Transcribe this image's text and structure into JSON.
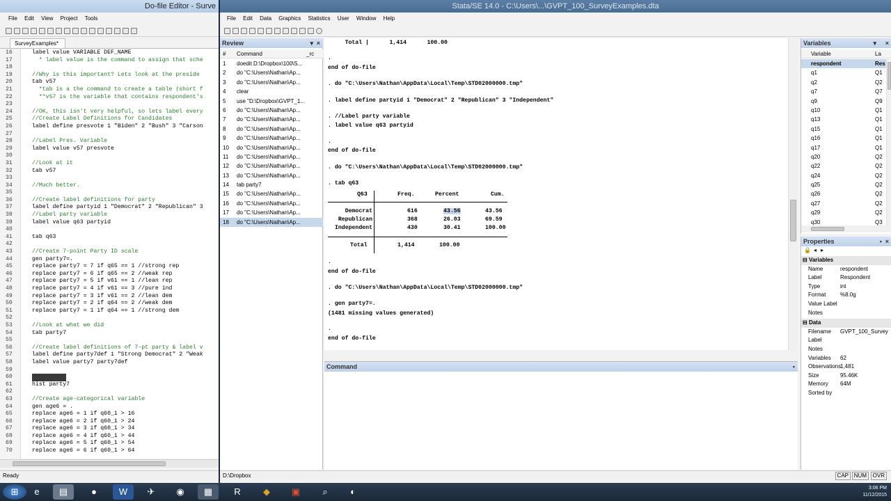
{
  "dofile": {
    "title": "Do-file Editor - Surve",
    "menu": [
      "File",
      "Edit",
      "View",
      "Project",
      "Tools"
    ],
    "tab": "SurveyExamples*",
    "status": "Ready",
    "lines": [
      {
        "n": "16",
        "t": "label value VARIABLE DEF_NAME"
      },
      {
        "n": "17",
        "t": "  * label value is the command to assign that sche"
      },
      {
        "n": "18",
        "t": ""
      },
      {
        "n": "19",
        "t": "//Why is this important? Lets look at the preside"
      },
      {
        "n": "20",
        "t": "tab v57"
      },
      {
        "n": "21",
        "t": "  *tab is a the command to create a table (short f"
      },
      {
        "n": "22",
        "t": "  **v57 is the variable that contains respondent's"
      },
      {
        "n": "23",
        "t": ""
      },
      {
        "n": "24",
        "t": "//OK, this isn't very helpful, so lets label every"
      },
      {
        "n": "25",
        "t": "//Create Label Definitions for Candidates"
      },
      {
        "n": "26",
        "t": "label define presvote 1 \"Biden\" 2 \"Bush\" 3 \"Carson"
      },
      {
        "n": "27",
        "t": ""
      },
      {
        "n": "28",
        "t": "//Label Pres. Variable"
      },
      {
        "n": "29",
        "t": "label value v57 presvote"
      },
      {
        "n": "30",
        "t": ""
      },
      {
        "n": "31",
        "t": "//Look at it"
      },
      {
        "n": "32",
        "t": "tab v57"
      },
      {
        "n": "33",
        "t": ""
      },
      {
        "n": "34",
        "t": "//Much better."
      },
      {
        "n": "35",
        "t": ""
      },
      {
        "n": "36",
        "t": "//Create label definitions for party"
      },
      {
        "n": "37",
        "t": "label define partyid 1 \"Democrat\" 2 \"Republican\" 3"
      },
      {
        "n": "38",
        "t": "//Label party variable"
      },
      {
        "n": "39",
        "t": "label value q63 partyid"
      },
      {
        "n": "40",
        "t": ""
      },
      {
        "n": "41",
        "t": "tab q63"
      },
      {
        "n": "42",
        "t": ""
      },
      {
        "n": "43",
        "t": "//Create 7-point Party ID scale"
      },
      {
        "n": "44",
        "t": "gen party7=."
      },
      {
        "n": "45",
        "t": "replace party7 = 7 if q65 == 1 //strong rep"
      },
      {
        "n": "46",
        "t": "replace party7 = 6 if q65 == 2 //weak rep"
      },
      {
        "n": "47",
        "t": "replace party7 = 5 if v61 == 1 //lean rep"
      },
      {
        "n": "48",
        "t": "replace party7 = 4 if v61 == 3 //pure ind"
      },
      {
        "n": "49",
        "t": "replace party7 = 3 if v61 == 2 //lean dem"
      },
      {
        "n": "50",
        "t": "replace party7 = 2 if q64 == 2 //weak dem"
      },
      {
        "n": "51",
        "t": "replace party7 = 1 if q64 == 1 //strong dem"
      },
      {
        "n": "52",
        "t": ""
      },
      {
        "n": "53",
        "t": "//Look at what we did"
      },
      {
        "n": "54",
        "t": "tab party7"
      },
      {
        "n": "55",
        "t": ""
      },
      {
        "n": "56",
        "t": "//Create label definitions of 7-pt party & label v"
      },
      {
        "n": "57",
        "t": "label define party7def 1 \"Strong Democrat\" 2 \"Weak"
      },
      {
        "n": "58",
        "t": "label value party7 party7def"
      },
      {
        "n": "59",
        "t": ""
      },
      {
        "n": "60",
        "t": "tab party7"
      },
      {
        "n": "61",
        "t": "hist party7"
      },
      {
        "n": "62",
        "t": ""
      },
      {
        "n": "63",
        "t": "//Create age-categorical variable"
      },
      {
        "n": "64",
        "t": "gen age6 = ."
      },
      {
        "n": "65",
        "t": "replace age6 = 1 if q60_1 > 16"
      },
      {
        "n": "66",
        "t": "replace age6 = 2 if q60_1 > 24"
      },
      {
        "n": "67",
        "t": "replace age6 = 3 if q60_1 > 34"
      },
      {
        "n": "68",
        "t": "replace age6 = 4 if q60_1 > 44"
      },
      {
        "n": "69",
        "t": "replace age6 = 5 if q60_1 > 54"
      },
      {
        "n": "70",
        "t": "replace age6 = 6 if q60_1 > 64"
      }
    ]
  },
  "stata": {
    "title": "Stata/SE 14.0 - C:\\Users\\...\\GVPT_100_SurveyExamples.dta",
    "menu": [
      "File",
      "Edit",
      "Data",
      "Graphics",
      "Statistics",
      "User",
      "Window",
      "Help"
    ],
    "review": {
      "title": "Review",
      "col_num": "#",
      "col_cmd": "Command",
      "col_rc": "_rc",
      "rows": [
        {
          "n": "1",
          "c": "doedit D:\\Dropbox\\100\\S..."
        },
        {
          "n": "2",
          "c": "do \"C:\\Users\\Nathan\\Ap..."
        },
        {
          "n": "3",
          "c": "do \"C:\\Users\\Nathan\\Ap..."
        },
        {
          "n": "4",
          "c": "clear"
        },
        {
          "n": "5",
          "c": "use \"D:\\Dropbox\\GVPT_1..."
        },
        {
          "n": "6",
          "c": "do \"C:\\Users\\Nathan\\Ap..."
        },
        {
          "n": "7",
          "c": "do \"C:\\Users\\Nathan\\Ap..."
        },
        {
          "n": "8",
          "c": "do \"C:\\Users\\Nathan\\Ap..."
        },
        {
          "n": "9",
          "c": "do \"C:\\Users\\Nathan\\Ap..."
        },
        {
          "n": "10",
          "c": "do \"C:\\Users\\Nathan\\Ap..."
        },
        {
          "n": "11",
          "c": "do \"C:\\Users\\Nathan\\Ap..."
        },
        {
          "n": "12",
          "c": "do \"C:\\Users\\Nathan\\Ap..."
        },
        {
          "n": "13",
          "c": "do \"C:\\Users\\Nathan\\Ap..."
        },
        {
          "n": "14",
          "c": "tab party7"
        },
        {
          "n": "15",
          "c": "do \"C:\\Users\\Nathan\\Ap..."
        },
        {
          "n": "16",
          "c": "do \"C:\\Users\\Nathan\\Ap..."
        },
        {
          "n": "17",
          "c": "do \"C:\\Users\\Nathan\\Ap..."
        },
        {
          "n": "18",
          "c": "do \"C:\\Users\\Nathan\\Ap..."
        }
      ]
    },
    "results": {
      "top_total": "     Total |      1,414      100.00",
      "l1": ".",
      "l2": "end of do-file",
      "l3": ". do \"C:\\Users\\Nathan\\AppData\\Local\\Temp\\STD02000000.tmp\"",
      "l4": ". label define partyid 1 \"Democrat\" 2 \"Republican\" 3 \"Independent\"",
      "l5": ". //Label party variable",
      "l6": ". label value q63 partyid",
      "l7": ".",
      "l8": "end of do-file",
      "l9": ". do \"C:\\Users\\Nathan\\AppData\\Local\\Temp\\STD02000000.tmp\"",
      "l10": ". tab q63",
      "tab_header": {
        "var": "Q63",
        "freq": "Freq.",
        "pct": "Percent",
        "cum": "Cum."
      },
      "tab_rows": [
        {
          "label": "Democrat",
          "freq": "616",
          "pct": "43.56",
          "cum": "43.56"
        },
        {
          "label": "Republican",
          "freq": "368",
          "pct": "26.03",
          "cum": "69.59"
        },
        {
          "label": "Independent",
          "freq": "430",
          "pct": "30.41",
          "cum": "100.00"
        }
      ],
      "tab_total": {
        "label": "Total",
        "freq": "1,414",
        "pct": "100.00"
      },
      "l11": ".",
      "l12": "end of do-file",
      "l13": ". do \"C:\\Users\\Nathan\\AppData\\Local\\Temp\\STD02000000.tmp\"",
      "l14": ". gen party7=.",
      "l15": "(1481 missing values generated)",
      "l16": ".",
      "l17": "end of do-file"
    },
    "command_title": "Command",
    "status_path": "D:\\Dropbox",
    "status_flags": [
      "CAP",
      "NUM",
      "OVR"
    ],
    "variables": {
      "title": "Variables",
      "col_var": "Variable",
      "col_label": "La",
      "rows": [
        {
          "v": "respondent",
          "l": "Res"
        },
        {
          "v": "q1",
          "l": "Q1"
        },
        {
          "v": "q2",
          "l": "Q2"
        },
        {
          "v": "q7",
          "l": "Q7"
        },
        {
          "v": "q9",
          "l": "Q9"
        },
        {
          "v": "q10",
          "l": "Q1"
        },
        {
          "v": "q13",
          "l": "Q1"
        },
        {
          "v": "q15",
          "l": "Q1"
        },
        {
          "v": "q16",
          "l": "Q1"
        },
        {
          "v": "q17",
          "l": "Q1"
        },
        {
          "v": "q20",
          "l": "Q2"
        },
        {
          "v": "q22",
          "l": "Q2"
        },
        {
          "v": "q24",
          "l": "Q2"
        },
        {
          "v": "q25",
          "l": "Q2"
        },
        {
          "v": "q26",
          "l": "Q2"
        },
        {
          "v": "q27",
          "l": "Q2"
        },
        {
          "v": "q29",
          "l": "Q2"
        },
        {
          "v": "q30",
          "l": "Q3"
        }
      ]
    },
    "properties": {
      "title": "Properties",
      "var_section": "Variables",
      "var_rows": [
        {
          "k": "Name",
          "v": "respondent"
        },
        {
          "k": "Label",
          "v": "Respondent"
        },
        {
          "k": "Type",
          "v": "int"
        },
        {
          "k": "Format",
          "v": "%8.0g"
        },
        {
          "k": "Value Label",
          "v": ""
        },
        {
          "k": "Notes",
          "v": ""
        }
      ],
      "data_section": "Data",
      "data_rows": [
        {
          "k": "Filename",
          "v": "GVPT_100_Survey"
        },
        {
          "k": "Label",
          "v": ""
        },
        {
          "k": "Notes",
          "v": ""
        },
        {
          "k": "Variables",
          "v": "62"
        },
        {
          "k": "Observations",
          "v": "1,481"
        },
        {
          "k": "Size",
          "v": "95.46K"
        },
        {
          "k": "Memory",
          "v": "64M"
        },
        {
          "k": "Sorted by",
          "v": ""
        }
      ]
    }
  },
  "taskbar": {
    "time": "3:06 PM",
    "date": "11/12/2015"
  }
}
